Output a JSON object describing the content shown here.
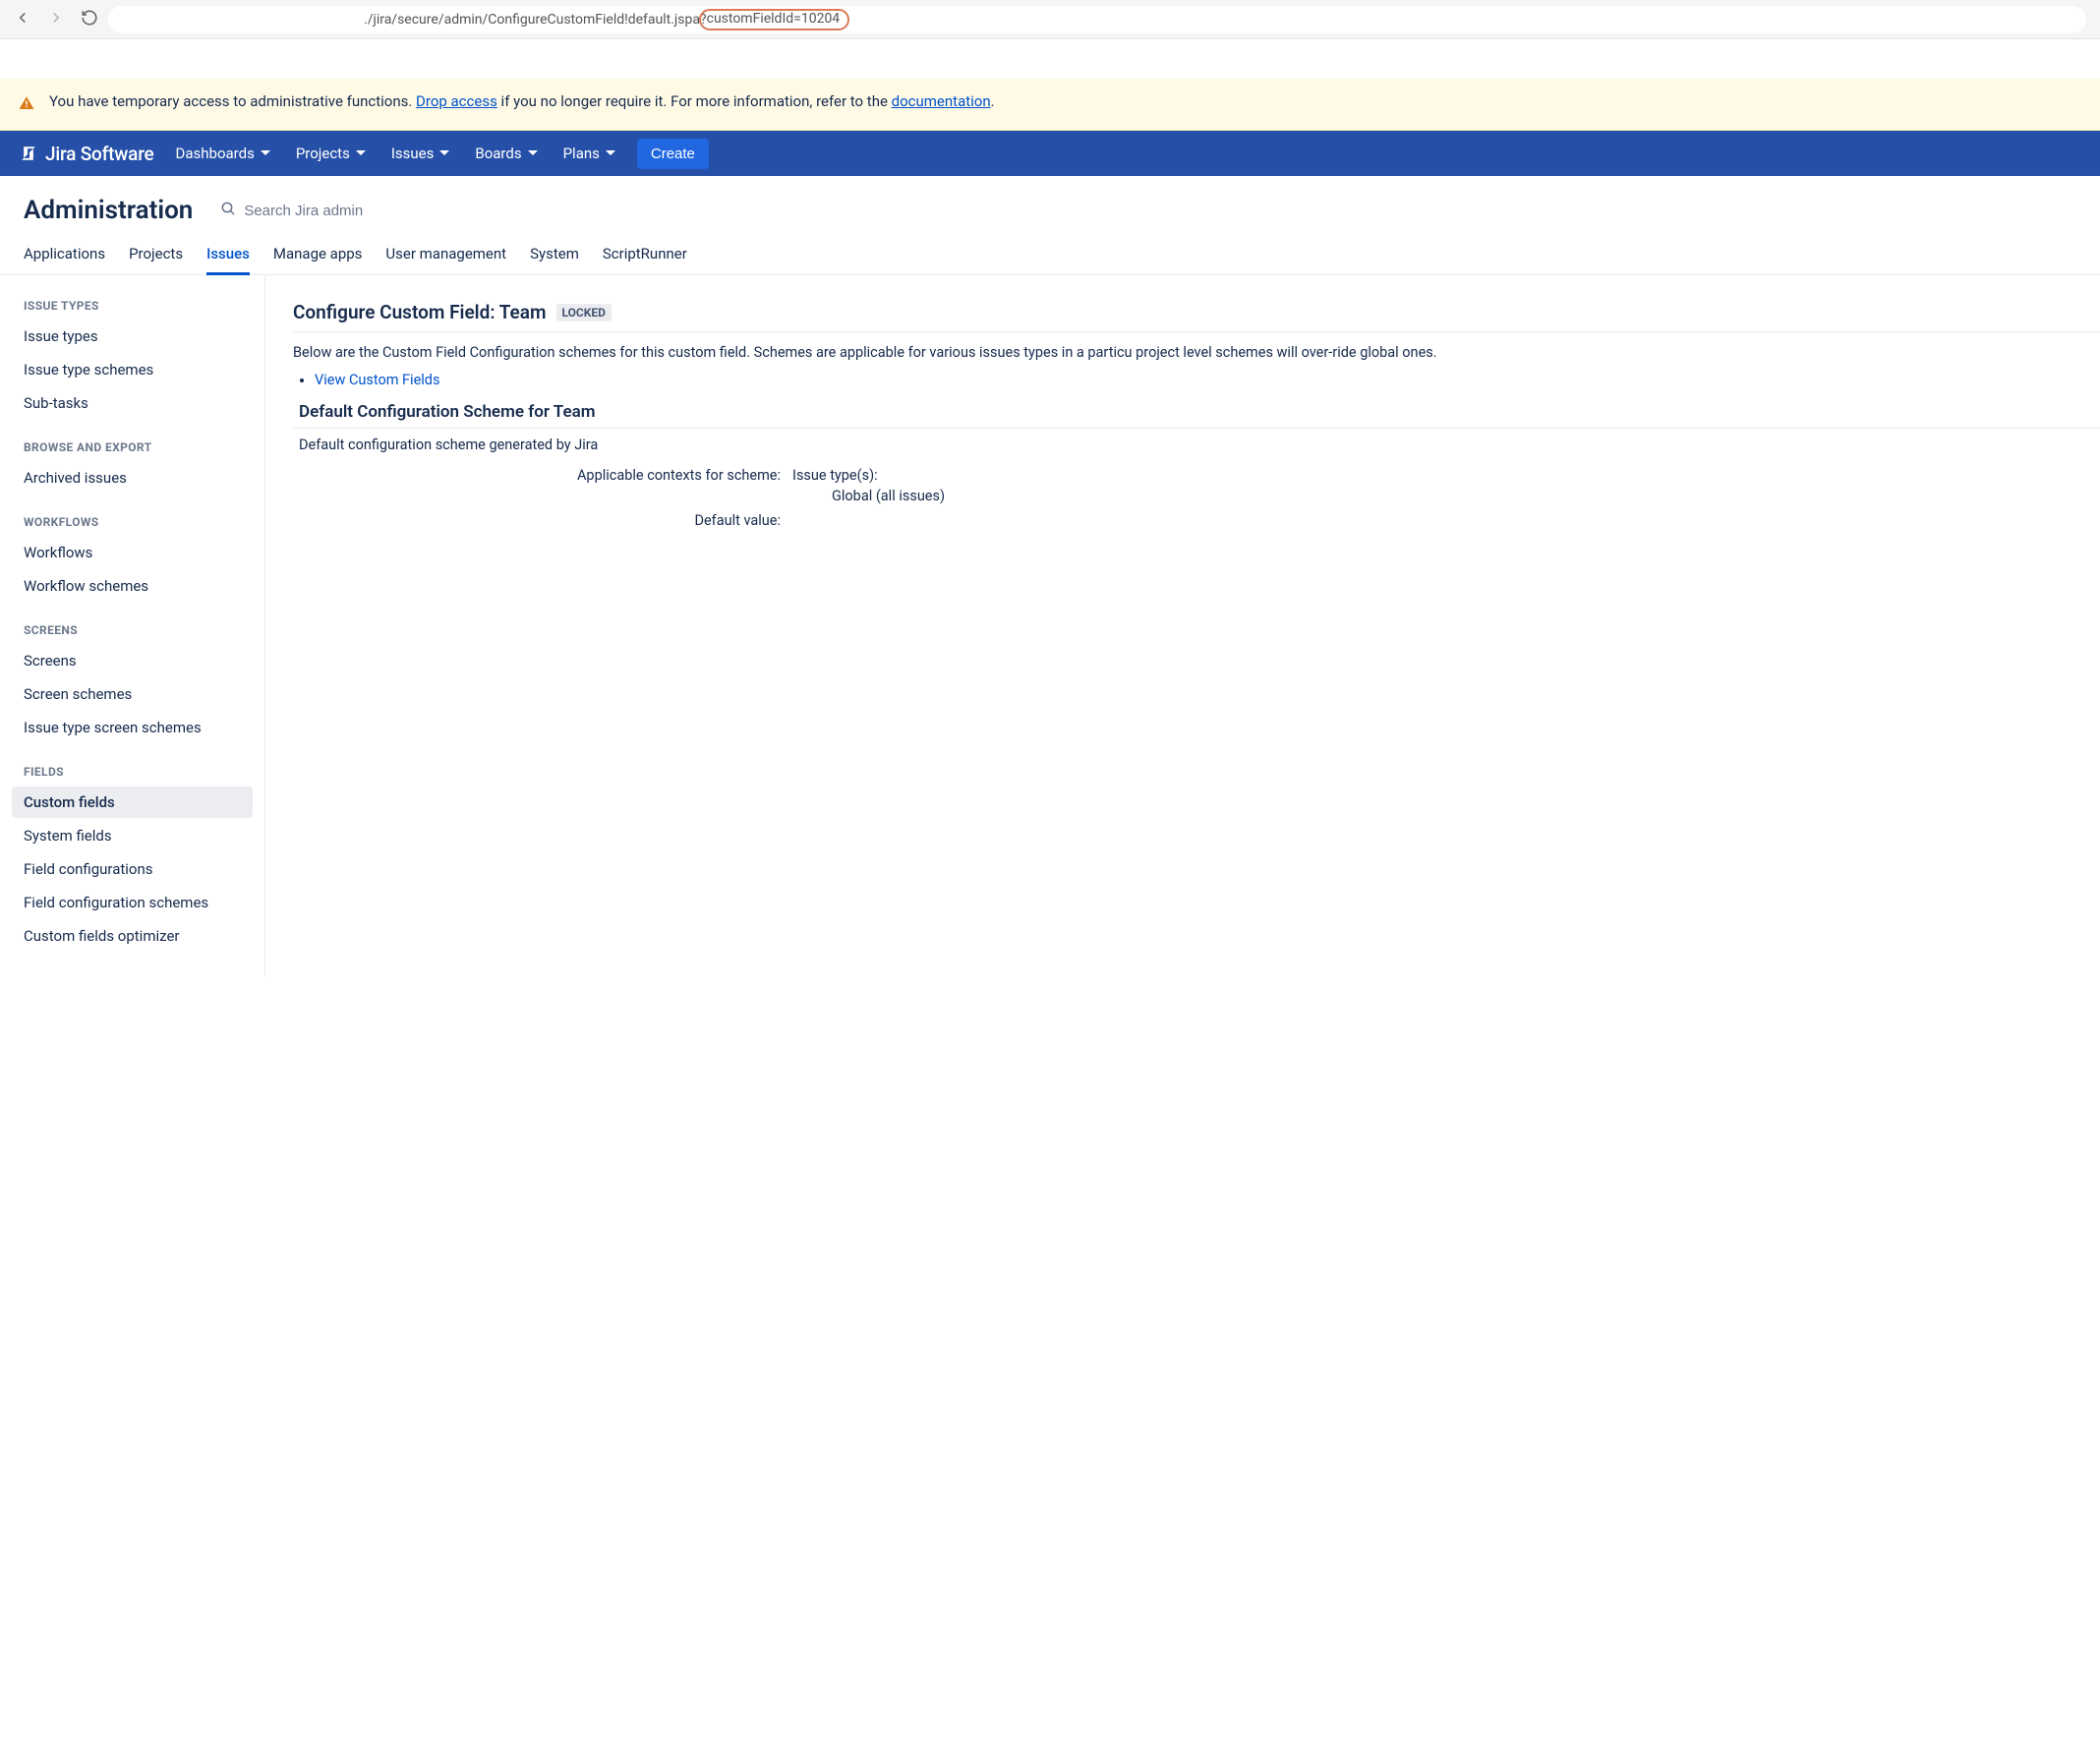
{
  "browser": {
    "url_prefix": "./jira/secure/admin/ConfigureCustomField!default.jspa?",
    "url_highlight": "customFieldId=10204"
  },
  "banner": {
    "text_before": "You have temporary access to administrative functions. ",
    "link1": "Drop access",
    "text_mid": " if you no longer require it. For more information, refer to the ",
    "link2": "documentation",
    "text_after": "."
  },
  "topnav": {
    "logo": "Jira Software",
    "items": [
      "Dashboards",
      "Projects",
      "Issues",
      "Boards",
      "Plans"
    ],
    "create": "Create"
  },
  "admin": {
    "title": "Administration",
    "search_placeholder": "Search Jira admin"
  },
  "tabs": [
    "Applications",
    "Projects",
    "Issues",
    "Manage apps",
    "User management",
    "System",
    "ScriptRunner"
  ],
  "active_tab_index": 2,
  "sidebar": {
    "groups": [
      {
        "title": "ISSUE TYPES",
        "items": [
          "Issue types",
          "Issue type schemes",
          "Sub-tasks"
        ]
      },
      {
        "title": "BROWSE AND EXPORT",
        "items": [
          "Archived issues"
        ]
      },
      {
        "title": "WORKFLOWS",
        "items": [
          "Workflows",
          "Workflow schemes"
        ]
      },
      {
        "title": "SCREENS",
        "items": [
          "Screens",
          "Screen schemes",
          "Issue type screen schemes"
        ]
      },
      {
        "title": "FIELDS",
        "items": [
          "Custom fields",
          "System fields",
          "Field configurations",
          "Field configuration schemes",
          "Custom fields optimizer"
        ]
      }
    ],
    "active": "Custom fields"
  },
  "page": {
    "heading": "Configure Custom Field: Team",
    "locked": "LOCKED",
    "desc": "Below are the Custom Field Configuration schemes for this custom field. Schemes are applicable for various issues types in a particu project level schemes will over-ride global ones.",
    "view_link": "View Custom Fields",
    "scheme_heading": "Default Configuration Scheme for Team",
    "scheme_sub": "Default configuration scheme generated by Jira",
    "contexts_label": "Applicable contexts for scheme:",
    "issue_types_label": "Issue type(s):",
    "issue_types_value": "Global (all issues)",
    "default_value_label": "Default value:"
  }
}
